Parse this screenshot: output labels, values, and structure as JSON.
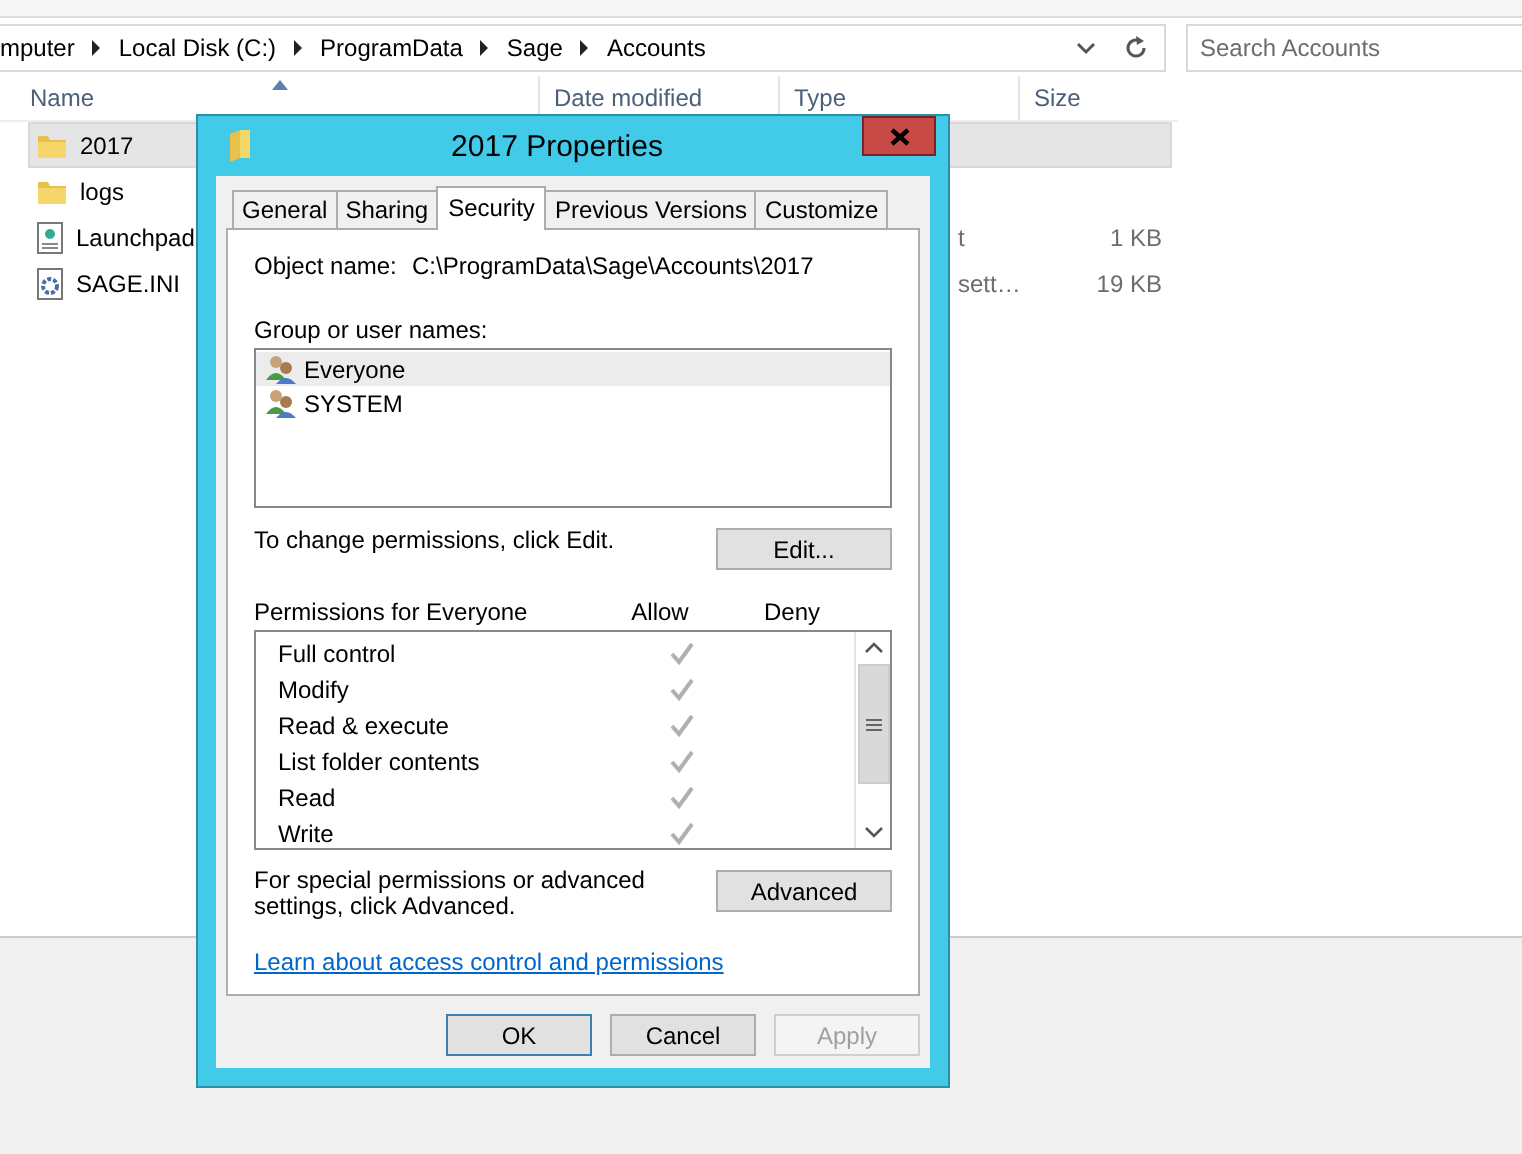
{
  "explorer": {
    "breadcrumb": [
      "mputer",
      "Local Disk (C:)",
      "ProgramData",
      "Sage",
      "Accounts"
    ],
    "search": {
      "placeholder": "Search Accounts"
    },
    "columns": [
      "Name",
      "Date modified",
      "Type",
      "Size"
    ],
    "files": [
      {
        "name": "2017",
        "kind": "folder",
        "selected": true
      },
      {
        "name": "logs",
        "kind": "folder",
        "selected": false
      },
      {
        "name": "Launchpad",
        "kind": "text",
        "type": "t",
        "size": "1 KB",
        "selected": false
      },
      {
        "name": "SAGE.INI",
        "kind": "settings",
        "type": "sett…",
        "size": "19 KB",
        "selected": false
      }
    ]
  },
  "dialog": {
    "title": "2017 Properties",
    "tabs": [
      {
        "label": "General",
        "selected": false
      },
      {
        "label": "Sharing",
        "selected": false
      },
      {
        "label": "Security",
        "selected": true
      },
      {
        "label": "Previous Versions",
        "selected": false
      },
      {
        "label": "Customize",
        "selected": false
      }
    ],
    "object_name_label": "Object name:",
    "object_name": "C:\\ProgramData\\Sage\\Accounts\\2017",
    "groups_label": "Group or user names:",
    "groups": [
      {
        "name": "Everyone",
        "selected": true
      },
      {
        "name": "SYSTEM",
        "selected": false
      }
    ],
    "change_hint": "To change permissions, click Edit.",
    "edit_button": "Edit...",
    "permissions_label": "Permissions for Everyone",
    "allow_header": "Allow",
    "deny_header": "Deny",
    "permissions": [
      {
        "name": "Full control",
        "allow": true,
        "deny": false
      },
      {
        "name": "Modify",
        "allow": true,
        "deny": false
      },
      {
        "name": "Read & execute",
        "allow": true,
        "deny": false
      },
      {
        "name": "List folder contents",
        "allow": true,
        "deny": false
      },
      {
        "name": "Read",
        "allow": true,
        "deny": false
      },
      {
        "name": "Write",
        "allow": true,
        "deny": false
      }
    ],
    "advanced_hint": "For special permissions or advanced settings, click Advanced.",
    "advanced_button": "Advanced",
    "link": "Learn about access control and permissions",
    "buttons": [
      {
        "label": "OK",
        "default": true,
        "disabled": false
      },
      {
        "label": "Cancel",
        "default": false,
        "disabled": false
      },
      {
        "label": "Apply",
        "default": false,
        "disabled": true
      }
    ]
  }
}
